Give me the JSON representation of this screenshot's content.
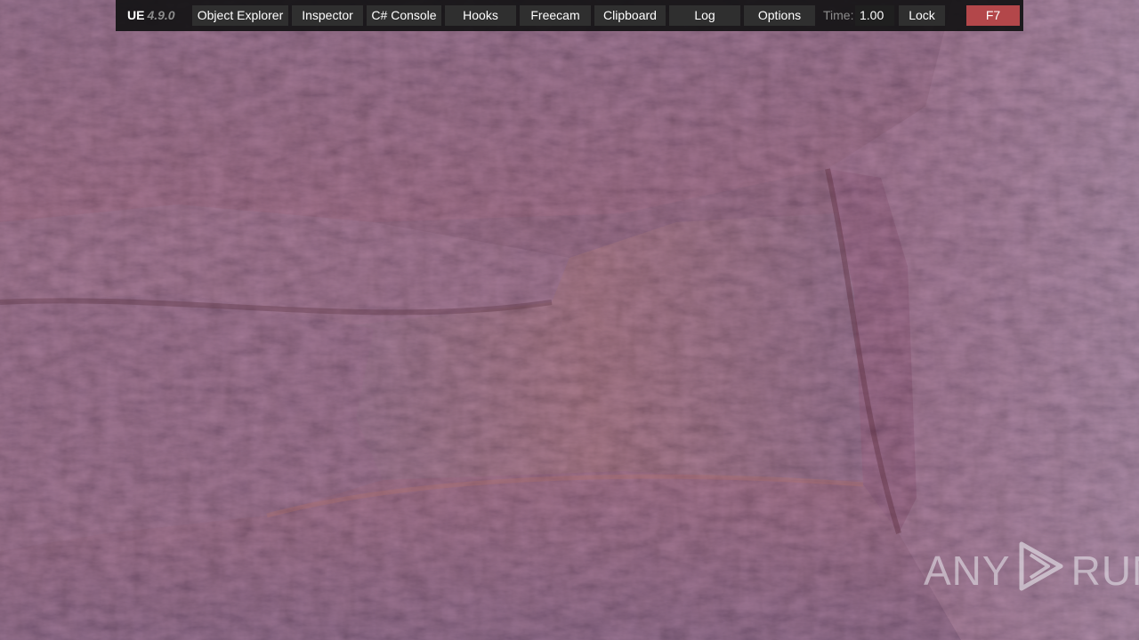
{
  "scene": {
    "description_icon": "cave-rock-scene",
    "palette": {
      "base": "#6e3f4a",
      "rock_red": "#8a4a55",
      "rock_orange": "#a05a4c",
      "rock_purple": "#7a5a7e",
      "rock_dark": "#4f2d3c",
      "wall_light": "#9a7582"
    }
  },
  "toolbar": {
    "brand": "UE",
    "version": "4.9.0",
    "buttons": [
      {
        "label": "Object Explorer"
      },
      {
        "label": "Inspector"
      },
      {
        "label": "C# Console"
      },
      {
        "label": "Hooks"
      },
      {
        "label": "Freecam"
      },
      {
        "label": "Clipboard"
      },
      {
        "label": "Log"
      },
      {
        "label": "Options"
      }
    ],
    "time_label": "Time:",
    "time_value": "1.00",
    "lock_label": "Lock",
    "toggle_label": "F7",
    "toggle_color": "#b3474a"
  },
  "watermark": {
    "left_text": "ANY",
    "right_text": "RUN",
    "logo_icon": "play-triangle-icon"
  }
}
